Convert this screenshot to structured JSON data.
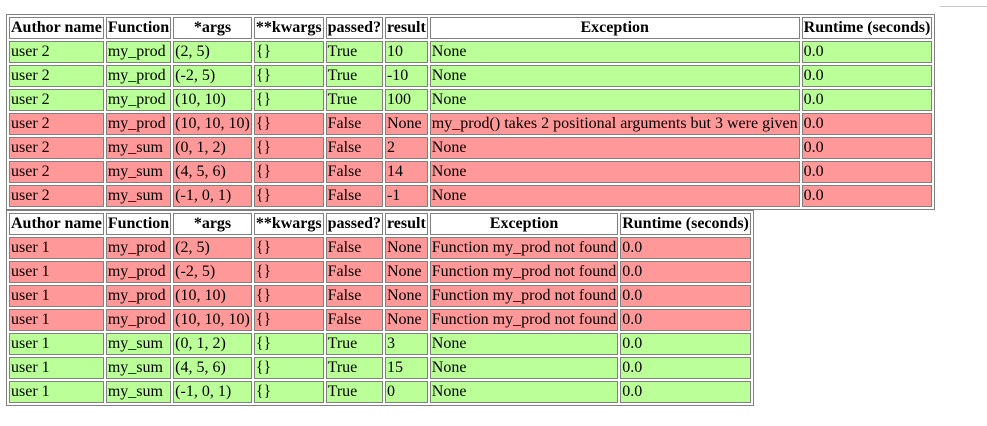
{
  "headers": [
    "Author name",
    "Function",
    "*args",
    "**kwargs",
    "passed?",
    "result",
    "Exception",
    "Runtime (seconds)"
  ],
  "colors": {
    "pass": "#bbff99",
    "fail": "#ff9999",
    "border": "#808080"
  },
  "tables": [
    {
      "rows": [
        {
          "status": "pass",
          "cells": [
            "user 2",
            "my_prod",
            "(2, 5)",
            "{}",
            "True",
            "10",
            "None",
            "0.0"
          ]
        },
        {
          "status": "pass",
          "cells": [
            "user 2",
            "my_prod",
            "(-2, 5)",
            "{}",
            "True",
            "-10",
            "None",
            "0.0"
          ]
        },
        {
          "status": "pass",
          "cells": [
            "user 2",
            "my_prod",
            "(10, 10)",
            "{}",
            "True",
            "100",
            "None",
            "0.0"
          ]
        },
        {
          "status": "fail",
          "cells": [
            "user 2",
            "my_prod",
            "(10, 10, 10)",
            "{}",
            "False",
            "None",
            "my_prod() takes 2 positional arguments but 3 were given",
            "0.0"
          ]
        },
        {
          "status": "fail",
          "cells": [
            "user 2",
            "my_sum",
            "(0, 1, 2)",
            "{}",
            "False",
            "2",
            "None",
            "0.0"
          ]
        },
        {
          "status": "fail",
          "cells": [
            "user 2",
            "my_sum",
            "(4, 5, 6)",
            "{}",
            "False",
            "14",
            "None",
            "0.0"
          ]
        },
        {
          "status": "fail",
          "cells": [
            "user 2",
            "my_sum",
            "(-1, 0, 1)",
            "{}",
            "False",
            "-1",
            "None",
            "0.0"
          ]
        }
      ]
    },
    {
      "rows": [
        {
          "status": "fail",
          "cells": [
            "user 1",
            "my_prod",
            "(2, 5)",
            "{}",
            "False",
            "None",
            "Function my_prod not found",
            "0.0"
          ]
        },
        {
          "status": "fail",
          "cells": [
            "user 1",
            "my_prod",
            "(-2, 5)",
            "{}",
            "False",
            "None",
            "Function my_prod not found",
            "0.0"
          ]
        },
        {
          "status": "fail",
          "cells": [
            "user 1",
            "my_prod",
            "(10, 10)",
            "{}",
            "False",
            "None",
            "Function my_prod not found",
            "0.0"
          ]
        },
        {
          "status": "fail",
          "cells": [
            "user 1",
            "my_prod",
            "(10, 10, 10)",
            "{}",
            "False",
            "None",
            "Function my_prod not found",
            "0.0"
          ]
        },
        {
          "status": "pass",
          "cells": [
            "user 1",
            "my_sum",
            "(0, 1, 2)",
            "{}",
            "True",
            "3",
            "None",
            "0.0"
          ]
        },
        {
          "status": "pass",
          "cells": [
            "user 1",
            "my_sum",
            "(4, 5, 6)",
            "{}",
            "True",
            "15",
            "None",
            "0.0"
          ]
        },
        {
          "status": "pass",
          "cells": [
            "user 1",
            "my_sum",
            "(-1, 0, 1)",
            "{}",
            "True",
            "0",
            "None",
            "0.0"
          ]
        }
      ]
    }
  ]
}
